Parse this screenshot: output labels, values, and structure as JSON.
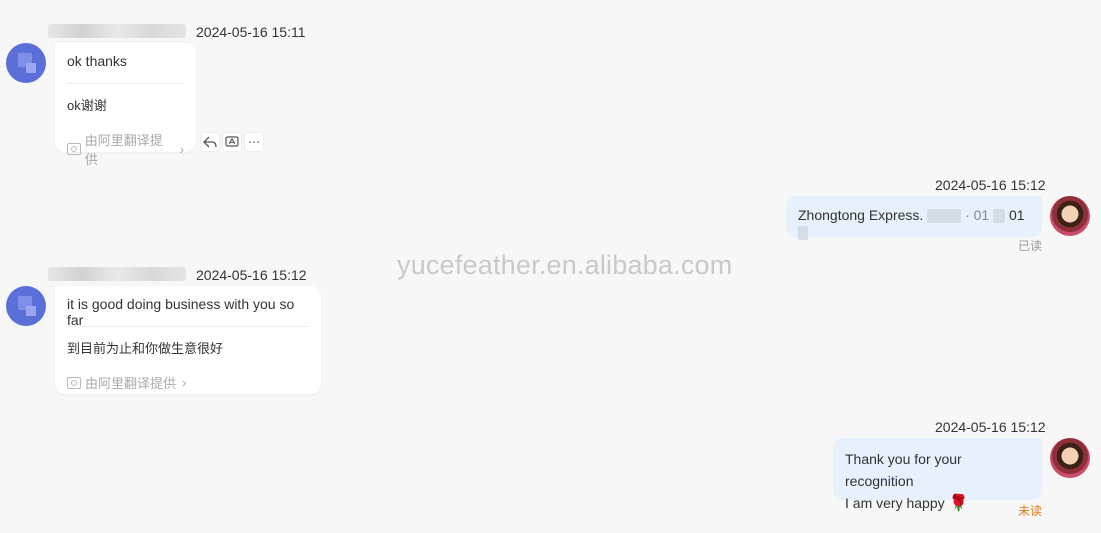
{
  "watermark": "yucefeather.en.alibaba.com",
  "messages": [
    {
      "timestamp": "2024-05-16 15:11",
      "original": "ok thanks",
      "translation": "ok谢谢",
      "provider": "由阿里翻译提供"
    },
    {
      "timestamp": "2024-05-16 15:12",
      "text_prefix": "Zhongtong Express.",
      "text_mid": "· 01",
      "text_suffix": "01",
      "status": "已读",
      "status_color": "#999999"
    },
    {
      "timestamp": "2024-05-16 15:12",
      "original": "it is good doing business with you so far",
      "translation": "到目前为止和你做生意很好",
      "provider": "由阿里翻译提供"
    },
    {
      "timestamp": "2024-05-16 15:12",
      "line1": "Thank you for your recognition",
      "line2": "I am very happy",
      "emoji": "🌹",
      "status": "未读",
      "status_color": "#e07a1a"
    }
  ],
  "toolbar": {
    "reply_icon": "reply-icon",
    "translate_icon": "translate-icon",
    "more_label": "⋯"
  },
  "colors": {
    "incoming_bg": "#ffffff",
    "outgoing_bg": "#e6f1fd",
    "avatar_blue": "#5b6fd8"
  }
}
